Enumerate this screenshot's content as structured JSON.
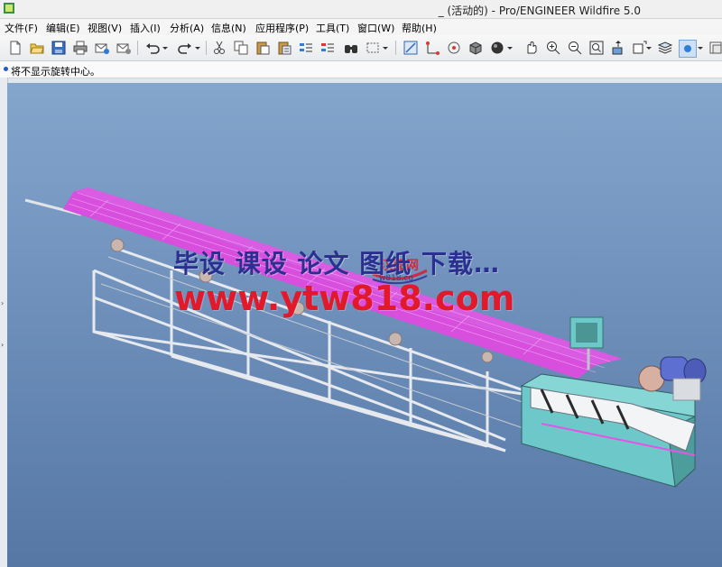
{
  "window": {
    "title": "_ (活动的) - Pro/ENGINEER Wildfire 5.0"
  },
  "menu": {
    "items": [
      "文件(F)",
      "编辑(E)",
      "视图(V)",
      "插入(I)",
      "分析(A)",
      "信息(N)",
      "应用程序(P)",
      "工具(T)",
      "窗口(W)",
      "帮助(H)"
    ]
  },
  "toolbar": {
    "icons": [
      "new-icon",
      "open-icon",
      "save-icon",
      "print-icon",
      "email-icon",
      "email-attach-icon",
      "undo-icon",
      "redo-icon",
      "cut-icon",
      "copy-icon",
      "paste-icon",
      "paste-special-icon",
      "regenerate-icon",
      "regenerate-manager-icon",
      "find-icon",
      "select-box-icon",
      "model-tree-icon",
      "datum-axis-icon",
      "datum-point-icon",
      "shading-icon",
      "sphere-icon",
      "spin-center-icon",
      "zoom-in-icon",
      "zoom-out-icon",
      "refit-icon",
      "orient-icon",
      "saved-views-icon",
      "layers-icon",
      "display-style-icon",
      "more-icon"
    ]
  },
  "status": {
    "message": "将不显示旋转中心。"
  },
  "watermark": {
    "line1": "毕设 课设 论文 图纸 下载…",
    "line2": "www.ytw818.com",
    "logo_text": "汉图网",
    "logo_sub": "w818.co"
  },
  "colors": {
    "viewport_top": "#84a6cd",
    "viewport_bottom": "#5677a4",
    "conveyor_pink": "#e455e6",
    "frame_gray": "#e6e9ee",
    "cabinet_teal": "#6dc9c9",
    "watermark_blue": "#2b2f8f",
    "watermark_red": "#e1192b"
  }
}
